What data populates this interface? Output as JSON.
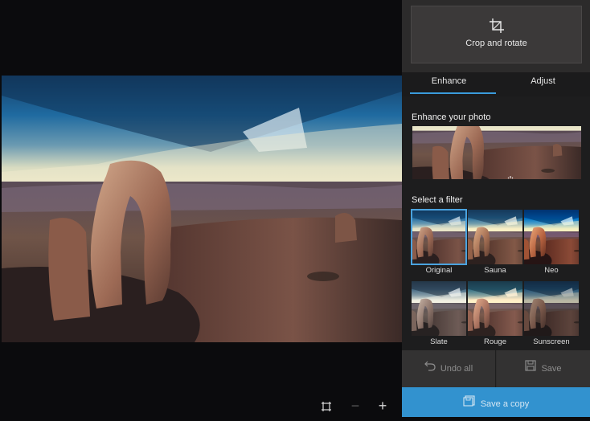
{
  "viewer": {
    "tools": [
      {
        "name": "fit-to-window-icon"
      },
      {
        "name": "zoom-out-icon"
      },
      {
        "name": "zoom-in-icon"
      }
    ]
  },
  "panel": {
    "crop_label": "Crop and rotate",
    "tabs": [
      {
        "label": "Enhance",
        "active": true
      },
      {
        "label": "Adjust",
        "active": false
      }
    ],
    "enhance_heading": "Enhance your photo",
    "filter_heading": "Select a filter",
    "filters": [
      {
        "label": "Original",
        "selected": true
      },
      {
        "label": "Sauna"
      },
      {
        "label": "Neo"
      },
      {
        "label": "Slate"
      },
      {
        "label": "Rouge"
      },
      {
        "label": "Sunscreen"
      }
    ],
    "undo_label": "Undo all",
    "save_label": "Save",
    "save_copy_label": "Save a copy"
  },
  "colors": {
    "accent": "#3292cf",
    "panel_bg": "#2c2b2b",
    "section_bg": "#1d1d1e"
  }
}
